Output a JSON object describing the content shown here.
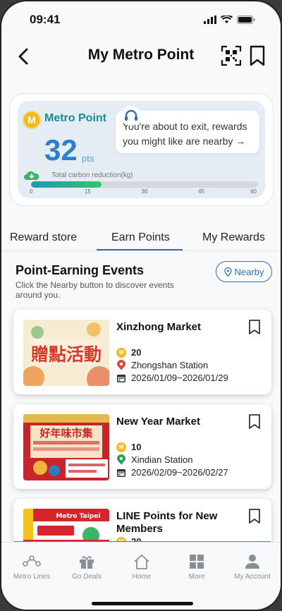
{
  "status": {
    "time": "09:41"
  },
  "header": {
    "title": "My Metro Point"
  },
  "points": {
    "brand": "Metro Point",
    "badge_letter": "M",
    "value": "32",
    "unit": "pts",
    "bubble_text": "You're about to exit, rewards you might like are nearby →",
    "carbon_label": "Total carbon reduction(kg)",
    "carbon_progress_fraction": 0.31,
    "ticks": [
      "0",
      "15",
      "30",
      "45",
      "60"
    ]
  },
  "tabs": [
    "Reward store",
    "Earn Points",
    "My Rewards"
  ],
  "section": {
    "title": "Point-Earning Events",
    "description": "Click the Nearby button to discover events around you.",
    "nearby_label": "Nearby"
  },
  "events": [
    {
      "title": "Xinzhong Market",
      "points": "20",
      "station": "Zhongshan Station",
      "dates": "2026/01/09~2026/01/29",
      "station_icon_color": "#e04a3a",
      "image_text": "贈點活動"
    },
    {
      "title": "New Year Market",
      "points": "10",
      "station": "Xindian Station",
      "dates": "2026/02/09~2026/02/27",
      "station_icon_color": "#27a058",
      "image_text": "好年味市集"
    },
    {
      "title": "LINE Points for New Members",
      "points": "20",
      "image_text": "Metro Taipei"
    }
  ],
  "nav": [
    "Metro Lines",
    "Go Deals",
    "Home",
    "More",
    "My Account"
  ],
  "colors": {
    "accent": "#2a6fb7",
    "coin": "#f5b920",
    "brand_teal": "#1b8b9a"
  }
}
